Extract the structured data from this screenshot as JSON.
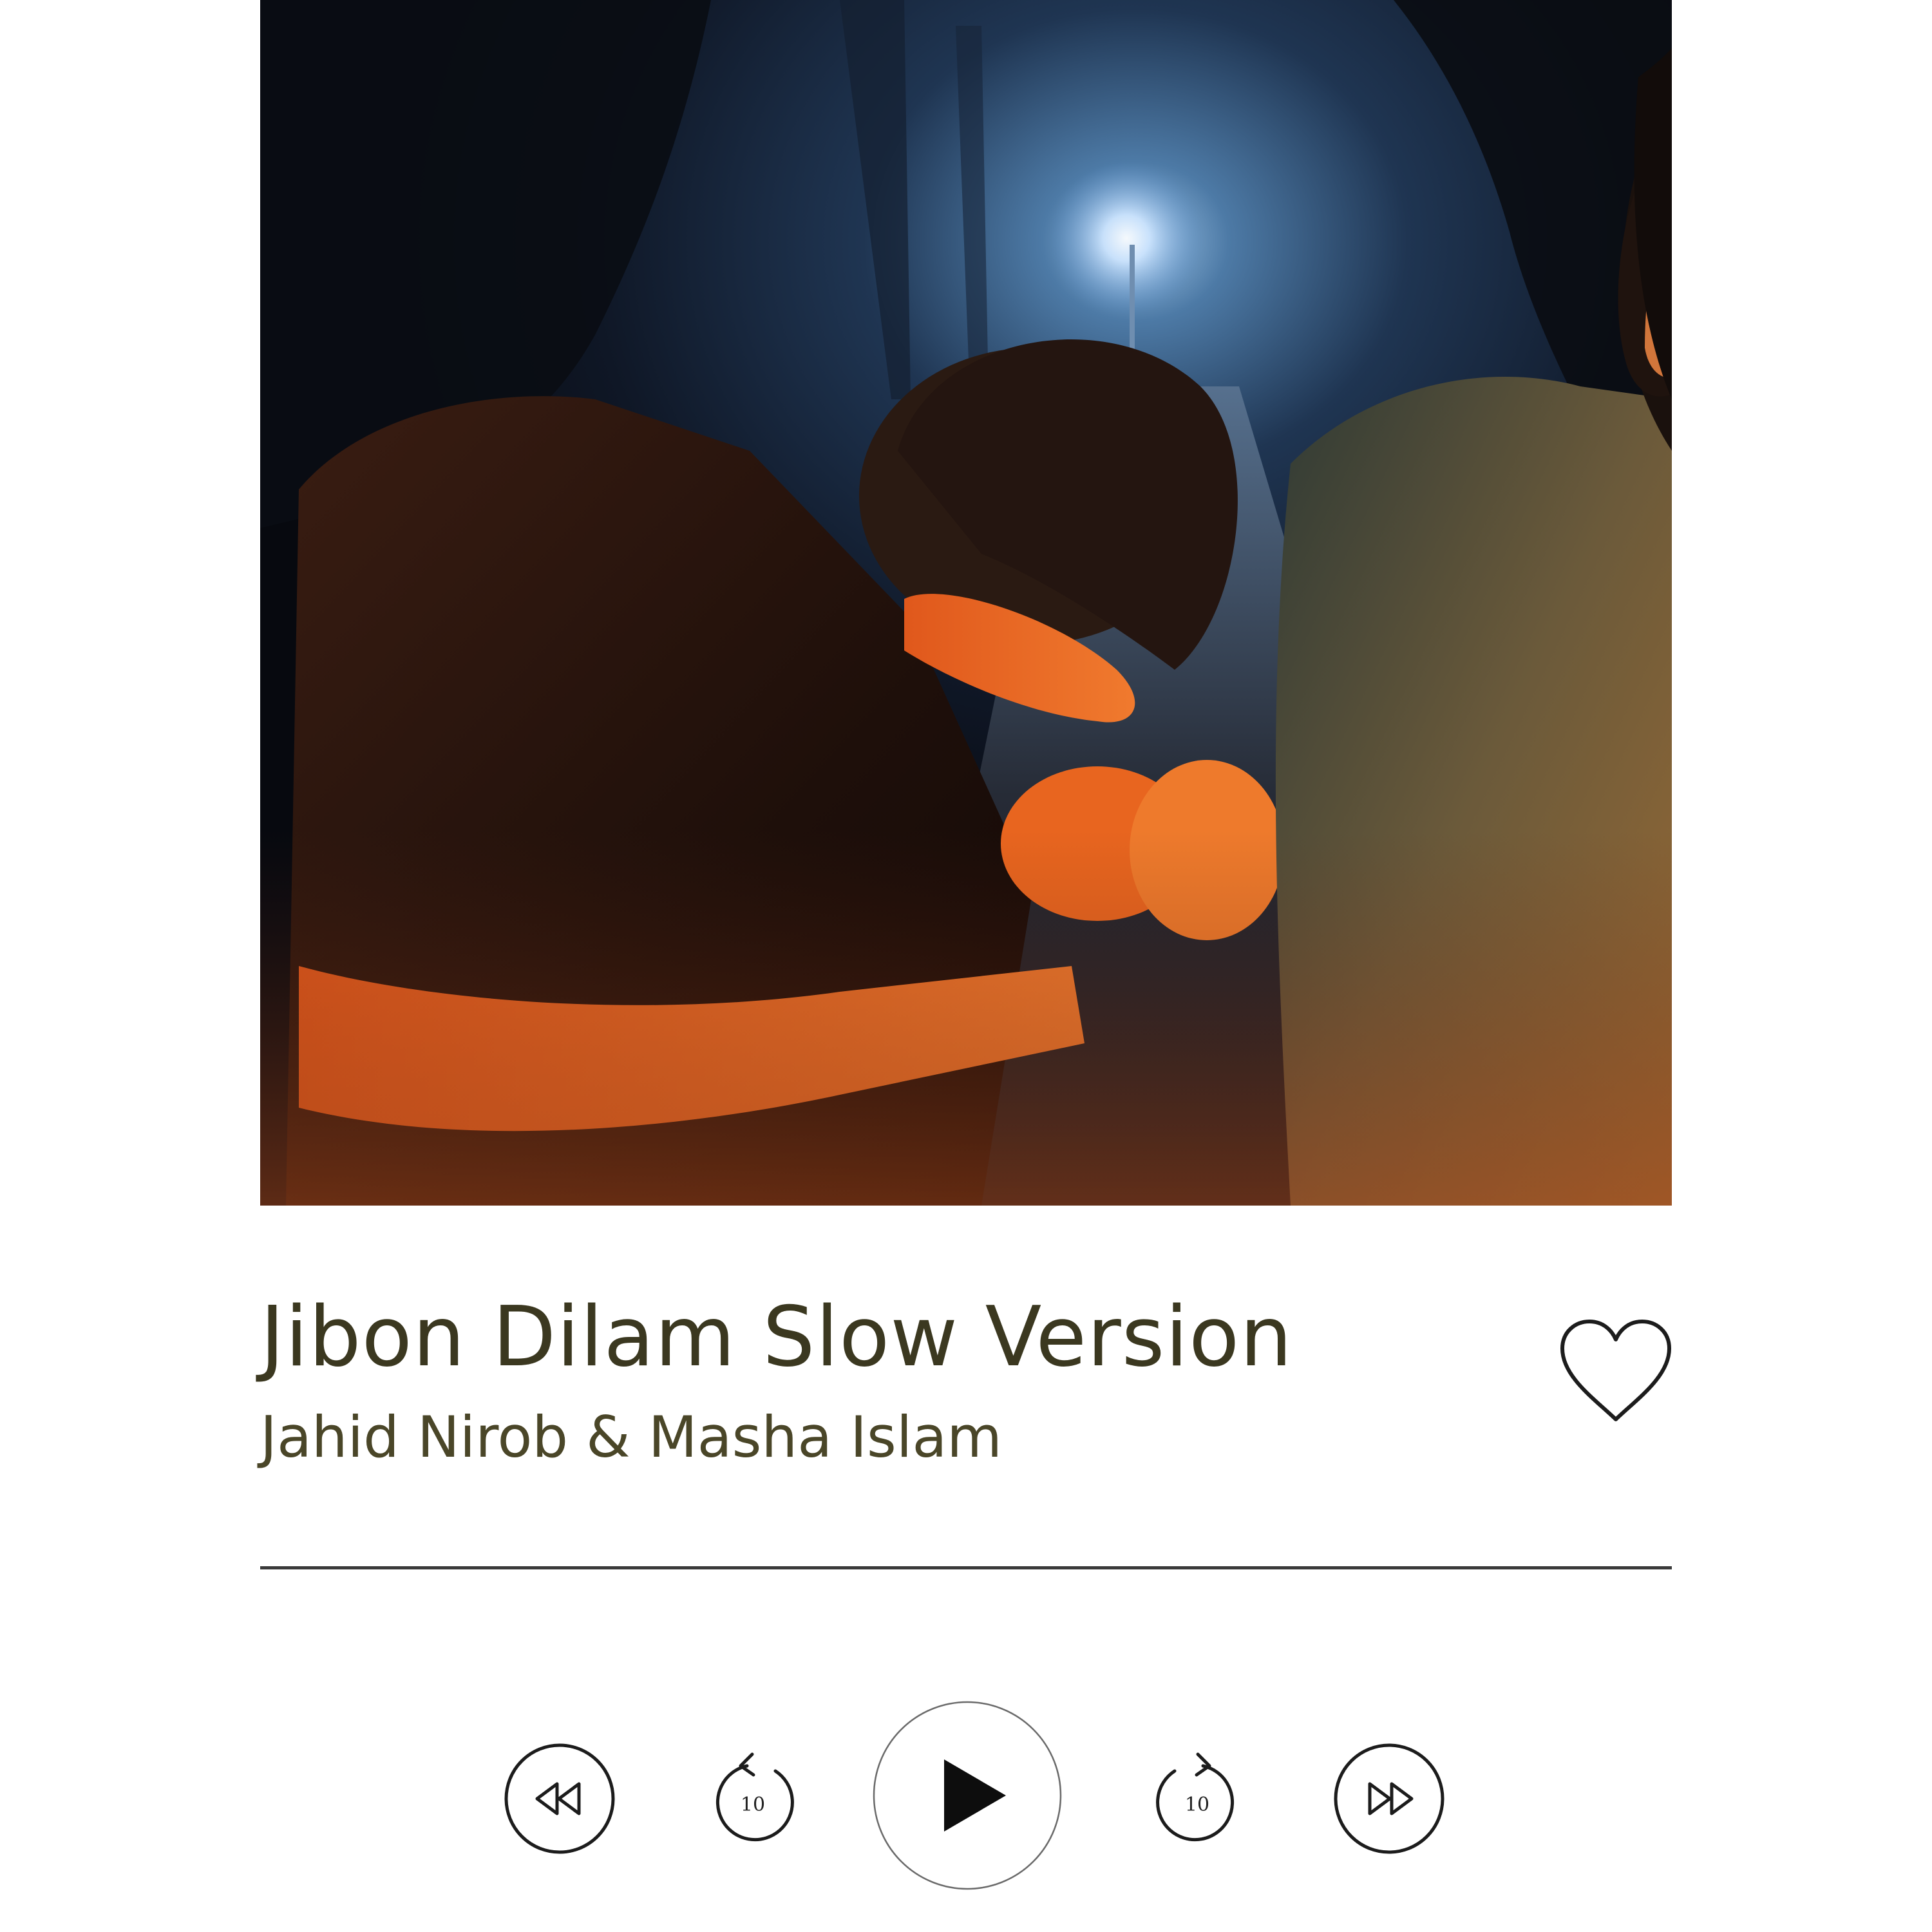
{
  "track": {
    "title": "Jibon Dilam Slow Version",
    "artist": "Jahid Nirob & Masha Islam",
    "liked": false,
    "progress": 1.0
  },
  "controls": {
    "previous_icon": "rewind-icon",
    "replay_icon": "replay-10-icon",
    "replay_label": "10",
    "play_icon": "play-icon",
    "forward_icon": "forward-10-icon",
    "forward_label": "10",
    "next_icon": "fast-forward-icon"
  },
  "colors": {
    "title": "#3b3820",
    "artist": "#4a4628",
    "icon_stroke": "#1c1c1c",
    "progress": "#3a3a3a"
  }
}
